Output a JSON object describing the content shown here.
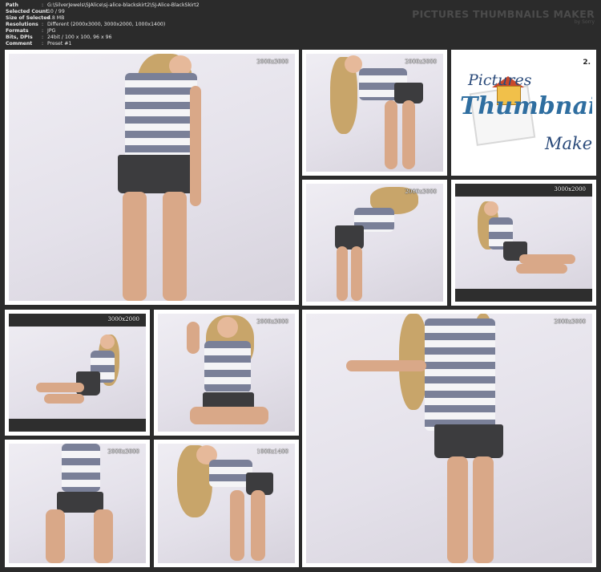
{
  "info": [
    {
      "key": "Path",
      "value": "G:\\SilverJewels\\SJAlice\\sj-alice-blackskirt2\\SJ-Alice-BlackSkirt2"
    },
    {
      "key": "Selected Count",
      "value": "10 / 99"
    },
    {
      "key": "Size of Selected",
      "value": "4.8 MB"
    },
    {
      "key": "Resolutions",
      "value": "Different (2000x3000, 3000x2000, 1000x1400)"
    },
    {
      "key": "Formats",
      "value": "JPG"
    },
    {
      "key": "Bits, DPIs",
      "value": "24bit / 100 x 100, 96 x 96"
    },
    {
      "key": "Comment",
      "value": "Preset #1"
    }
  ],
  "separator": ":",
  "brand": {
    "title": "PICTURES THUMBNAILS MAKER",
    "subtitle": "by Sorry"
  },
  "logo": {
    "line1": "Pictures",
    "line2": "Thumbnails",
    "line3": "Maker",
    "corner": "2."
  },
  "thumbnails": [
    {
      "resolution": "2000x3000"
    },
    {
      "resolution": "2000x3000"
    },
    {
      "resolution": "2000x3000"
    },
    {
      "resolution": "3000x2000"
    },
    {
      "resolution": "3000x2000"
    },
    {
      "resolution": "2000x3000"
    },
    {
      "resolution": "2000x3000"
    },
    {
      "resolution": "2000x3000"
    },
    {
      "resolution": "1000x1400"
    }
  ]
}
